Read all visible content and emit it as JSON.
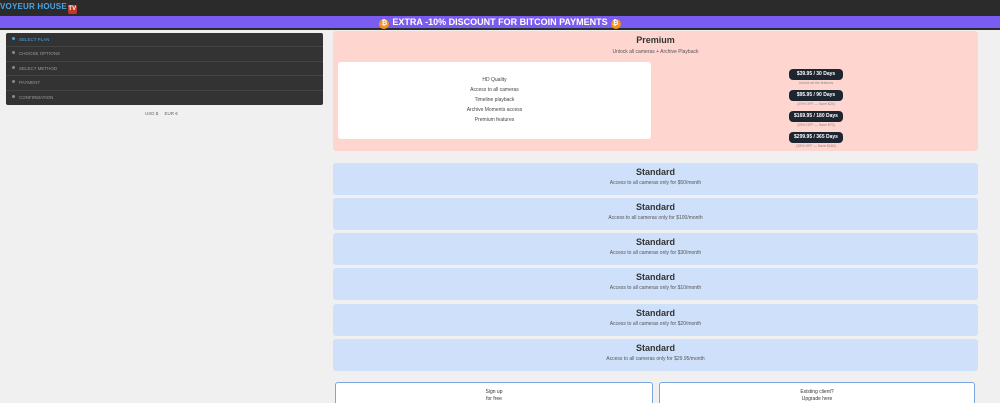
{
  "header": {
    "logo": "VOYEUR HOUSE",
    "logo_badge": "TV"
  },
  "promo": {
    "text": "EXTRA -10% DISCOUNT FOR BITCOIN PAYMENTS",
    "coin_glyph": "₿"
  },
  "steps": [
    {
      "label": "Select plan",
      "active": true
    },
    {
      "label": "Choose options",
      "active": false
    },
    {
      "label": "Select method",
      "active": false
    },
    {
      "label": "Payment",
      "active": false
    },
    {
      "label": "Confirmation",
      "active": false
    }
  ],
  "langs": [
    "USD $",
    "EUR €"
  ],
  "premium": {
    "title": "Premium",
    "subtitle": "Unlock all cameras + Archive Playback",
    "features": [
      "HD Quality",
      "Access to all cameras",
      "Timeline playback",
      "Archive Moments access",
      "Premium features"
    ],
    "prices": [
      {
        "label": "$39.95 / 30 Days",
        "note": "Unlock all the features"
      },
      {
        "label": "$95.95 / 90 Days",
        "note": "(20% OFF — Save $24)"
      },
      {
        "label": "$169.95 / 180 Days",
        "note": "(29% OFF — Save $70)"
      },
      {
        "label": "$299.95 / 365 Days",
        "note": "(38% OFF — Save $180)"
      }
    ]
  },
  "standard": [
    {
      "title": "Standard",
      "desc": "Access to all cameras only for $50/month"
    },
    {
      "title": "Standard",
      "desc": "Access to all cameras only for $100/month"
    },
    {
      "title": "Standard",
      "desc": "Access to all cameras only for $30/month"
    },
    {
      "title": "Standard",
      "desc": "Access to all cameras only for $10/month"
    },
    {
      "title": "Standard",
      "desc": "Access to all cameras only for $20/month"
    },
    {
      "title": "Standard",
      "desc": "Access to all cameras only for $29.95/month"
    }
  ],
  "cta": {
    "signup": {
      "line1": "Sign up",
      "line2": "for free"
    },
    "existing": {
      "line1": "Existing client?",
      "line2": "Upgrade here"
    }
  },
  "colors": {
    "premium_bg": "#ffd5d0",
    "standard_bg": "#cfe0fb",
    "promo_bg": "#7b5cf0",
    "accent": "#4aa3df"
  }
}
